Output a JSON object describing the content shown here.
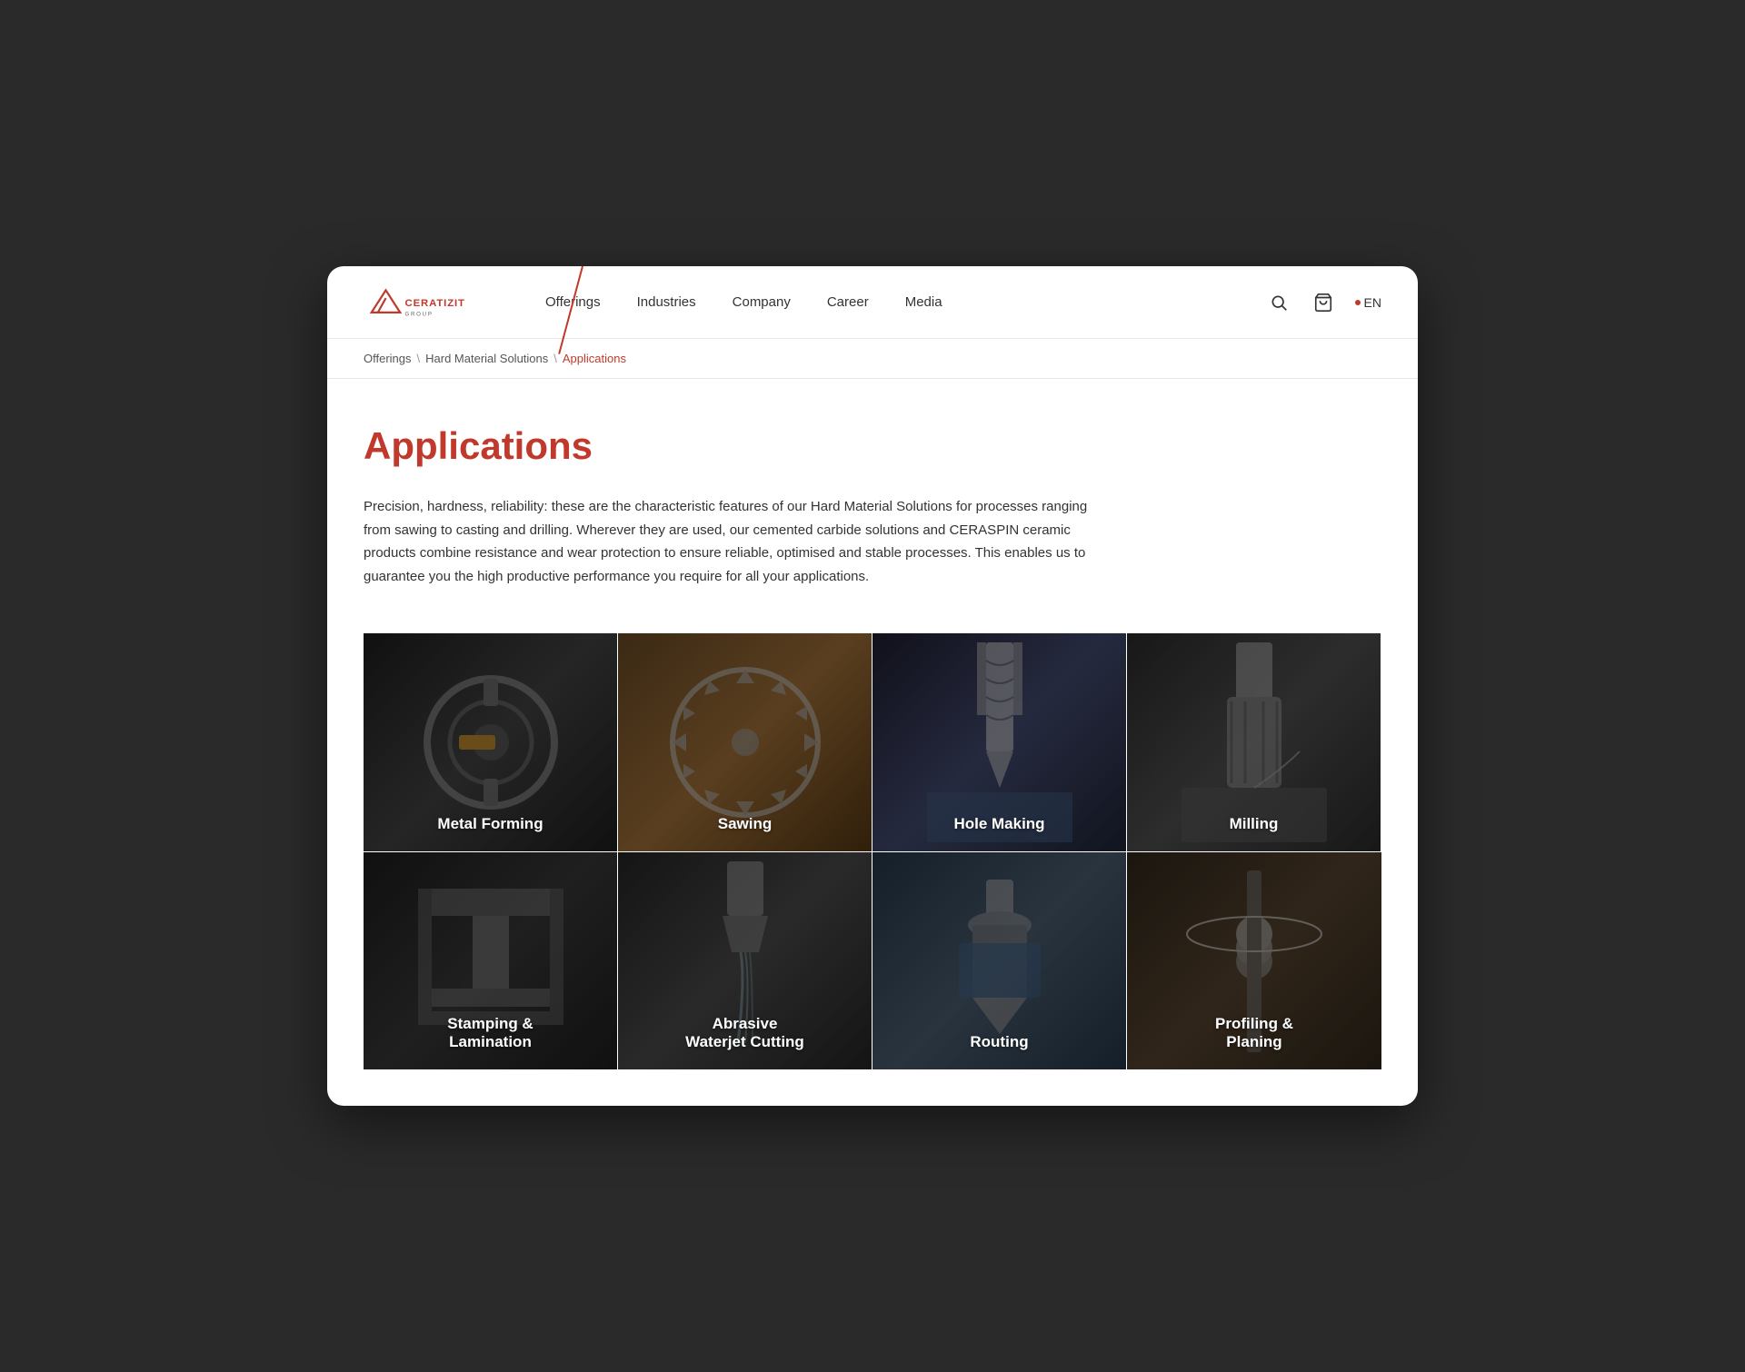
{
  "site": {
    "logo_text": "CERATIZIT",
    "logo_subtext": "GROUP"
  },
  "nav": {
    "links": [
      {
        "label": "Offerings",
        "id": "offerings"
      },
      {
        "label": "Industries",
        "id": "industries"
      },
      {
        "label": "Company",
        "id": "company"
      },
      {
        "label": "Career",
        "id": "career"
      },
      {
        "label": "Media",
        "id": "media"
      }
    ],
    "lang": "EN",
    "search_label": "🔍",
    "cart_label": "🛒"
  },
  "breadcrumb": {
    "items": [
      {
        "label": "Offerings",
        "active": false
      },
      {
        "label": "Hard Material Solutions",
        "active": false
      },
      {
        "label": "Applications",
        "active": true
      }
    ]
  },
  "page": {
    "title": "Applications",
    "description": "Precision, hardness, reliability: these are the characteristic features of our Hard Material Solutions for processes ranging from sawing to casting and drilling. Wherever they are used, our cemented carbide solutions and CERASPIN ceramic products combine resistance and wear protection to ensure reliable, optimised and stable processes. This enables us to guarantee you the high productive performance you require for all your applications."
  },
  "applications": {
    "cards": [
      {
        "id": "metal-forming",
        "label": "Metal Forming",
        "bg_class": "bg-metal-forming"
      },
      {
        "id": "sawing",
        "label": "Sawing",
        "bg_class": "bg-sawing"
      },
      {
        "id": "hole-making",
        "label": "Hole Making",
        "bg_class": "bg-hole-making"
      },
      {
        "id": "milling",
        "label": "Milling",
        "bg_class": "bg-milling"
      },
      {
        "id": "stamping-lamination",
        "label": "Stamping &\nLamination",
        "bg_class": "bg-stamping"
      },
      {
        "id": "abrasive-waterjet",
        "label": "Abrasive\nWaterjet Cutting",
        "bg_class": "bg-abrasive"
      },
      {
        "id": "routing",
        "label": "Routing",
        "bg_class": "bg-routing"
      },
      {
        "id": "profiling-planing",
        "label": "Profiling &\nPlaning",
        "bg_class": "bg-profiling"
      }
    ]
  }
}
